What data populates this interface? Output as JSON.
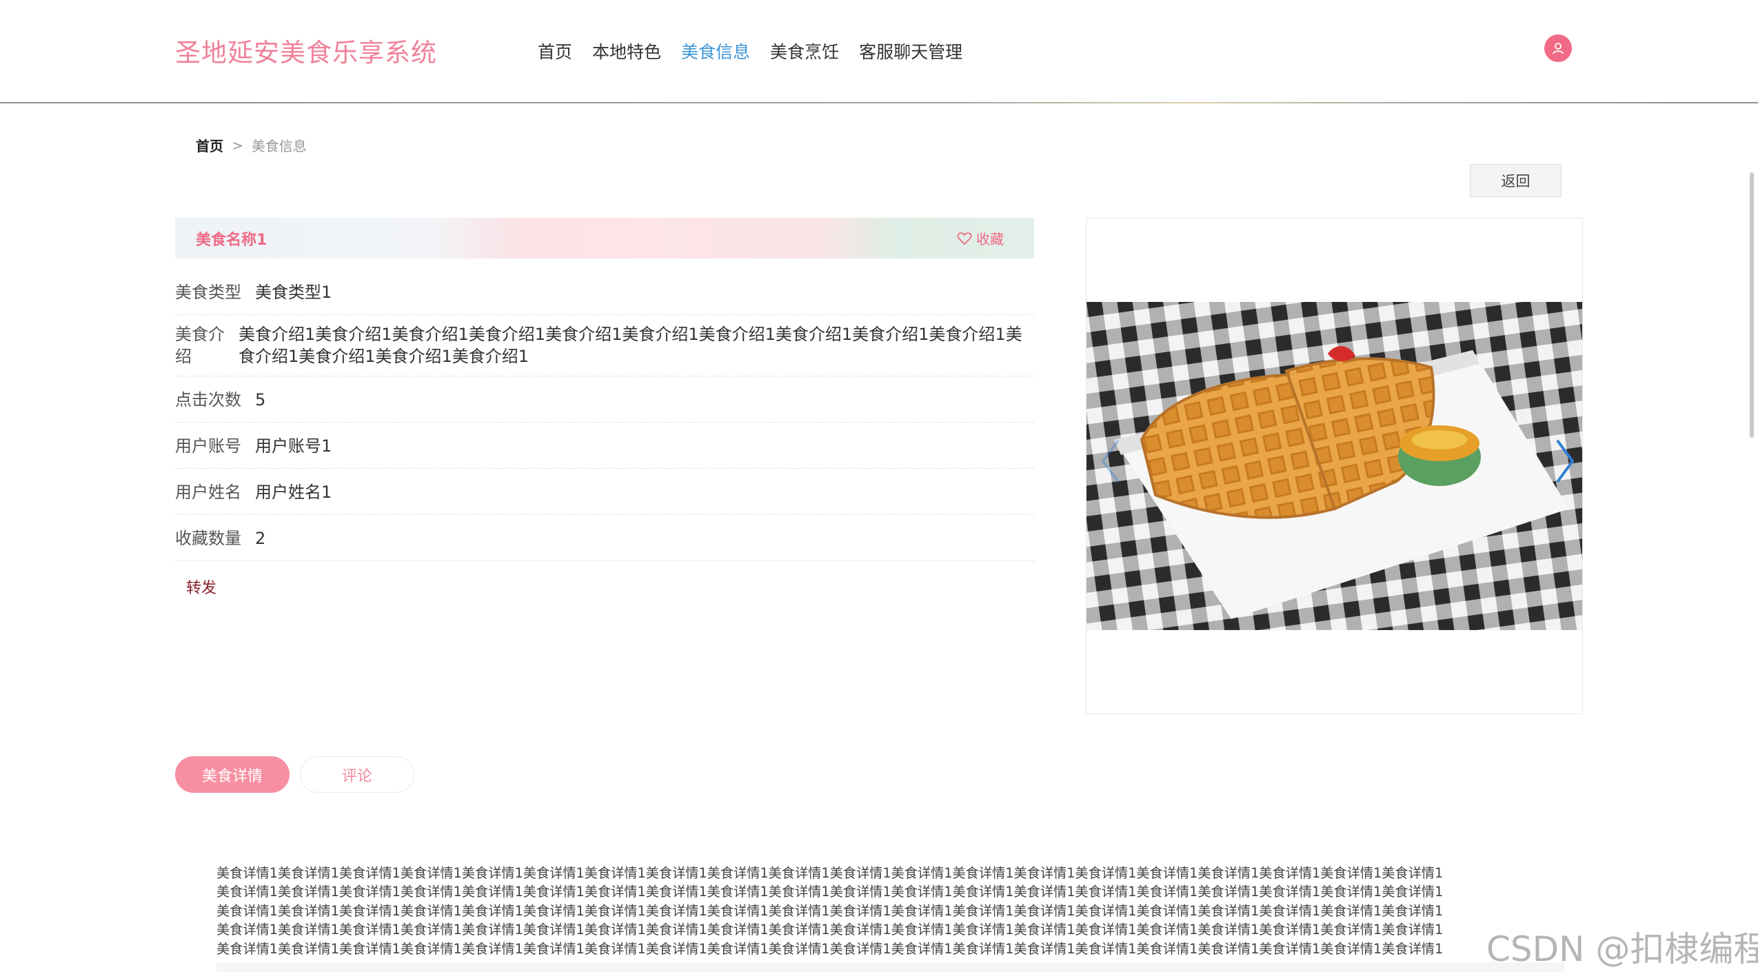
{
  "header": {
    "site_title": "圣地延安美食乐享系统",
    "nav": [
      {
        "label": "首页",
        "active": false
      },
      {
        "label": "本地特色",
        "active": false
      },
      {
        "label": "美食信息",
        "active": true
      },
      {
        "label": "美食烹饪",
        "active": false
      },
      {
        "label": "客服聊天管理",
        "active": false
      }
    ],
    "avatar_icon": "user-icon"
  },
  "breadcrumb": {
    "home": "首页",
    "separator": ">",
    "current": "美食信息"
  },
  "back_label": "返回",
  "food": {
    "name": "美食名称1",
    "favorite_label": "收藏",
    "fields": [
      {
        "label": "美食类型",
        "value": "美食类型1"
      },
      {
        "label": "美食介绍",
        "value": "美食介绍1美食介绍1美食介绍1美食介绍1美食介绍1美食介绍1美食介绍1美食介绍1美食介绍1美食介绍1美食介绍1美食介绍1美食介绍1美食介绍1"
      },
      {
        "label": "点击次数",
        "value": "5"
      },
      {
        "label": "用户账号",
        "value": "用户账号1"
      },
      {
        "label": "用户姓名",
        "value": "用户姓名1"
      },
      {
        "label": "收藏数量",
        "value": "2"
      }
    ],
    "share_label": "转发"
  },
  "carousel": {
    "image": "waffle-photo",
    "prev_icon": "chevron-left-icon",
    "next_icon": "chevron-right-icon"
  },
  "tabs": [
    {
      "label": "美食详情",
      "active": true
    },
    {
      "label": "评论",
      "active": false
    }
  ],
  "detail": {
    "lines": [
      "美食详情1美食详情1美食详情1美食详情1美食详情1美食详情1美食详情1美食详情1美食详情1美食详情1美食详情1美食详情1美食详情1美食详情1美食详情1美食详情1美食详情1美食详情1美食详情1美食详情1",
      "美食详情1美食详情1美食详情1美食详情1美食详情1美食详情1美食详情1美食详情1美食详情1美食详情1美食详情1美食详情1美食详情1美食详情1美食详情1美食详情1美食详情1美食详情1美食详情1美食详情1",
      "美食详情1美食详情1美食详情1美食详情1美食详情1美食详情1美食详情1美食详情1美食详情1美食详情1美食详情1美食详情1美食详情1美食详情1美食详情1美食详情1美食详情1美食详情1美食详情1美食详情1",
      "美食详情1美食详情1美食详情1美食详情1美食详情1美食详情1美食详情1美食详情1美食详情1美食详情1美食详情1美食详情1美食详情1美食详情1美食详情1美食详情1美食详情1美食详情1美食详情1美食详情1",
      "美食详情1美食详情1美食详情1美食详情1美食详情1美食详情1美食详情1美食详情1美食详情1美食详情1美食详情1美食详情1美食详情1美食详情1美食详情1美食详情1美食详情1美食详情1美食详情1美食详情1"
    ]
  },
  "watermark": "CSDN @扣棣编程",
  "colors": {
    "brand_pink": "#f06a85",
    "nav_active": "#3d95d8",
    "tab_active": "#f78fa1",
    "share": "#8a1d2c"
  }
}
